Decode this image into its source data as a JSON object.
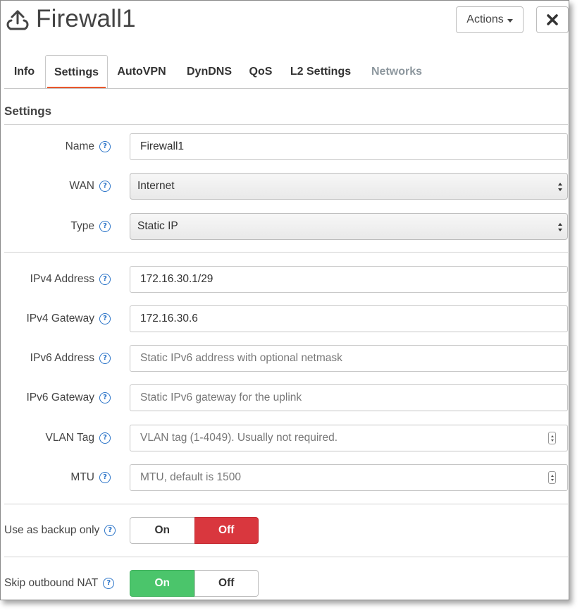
{
  "header": {
    "title": "Firewall1",
    "icon": "uplink-icon",
    "actions_label": "Actions",
    "close_icon": "close-icon"
  },
  "tabs": [
    {
      "label": "Info",
      "state": "normal"
    },
    {
      "label": "Settings",
      "state": "active"
    },
    {
      "label": "AutoVPN",
      "state": "normal"
    },
    {
      "label": "DynDNS",
      "state": "normal"
    },
    {
      "label": "QoS",
      "state": "normal"
    },
    {
      "label": "L2 Settings",
      "state": "normal"
    },
    {
      "label": "Networks",
      "state": "disabled"
    }
  ],
  "section": {
    "title": "Settings"
  },
  "help_glyph": "?",
  "fields": {
    "name": {
      "label": "Name",
      "value": "Firewall1"
    },
    "wan": {
      "label": "WAN",
      "value": "Internet"
    },
    "type": {
      "label": "Type",
      "value": "Static IP"
    },
    "ipv4_address": {
      "label": "IPv4 Address",
      "value": "172.16.30.1/29"
    },
    "ipv4_gateway": {
      "label": "IPv4 Gateway",
      "value": "172.16.30.6"
    },
    "ipv6_address": {
      "label": "IPv6 Address",
      "value": "",
      "placeholder": "Static IPv6 address with optional netmask"
    },
    "ipv6_gateway": {
      "label": "IPv6 Gateway",
      "value": "",
      "placeholder": "Static IPv6 gateway for the uplink"
    },
    "vlan_tag": {
      "label": "VLAN Tag",
      "value": "",
      "placeholder": "VLAN tag (1-4049). Usually not required."
    },
    "mtu": {
      "label": "MTU",
      "value": "",
      "placeholder": "MTU, default is 1500"
    }
  },
  "toggles": {
    "backup_only": {
      "label": "Use as backup only",
      "on_label": "On",
      "off_label": "Off",
      "selected": "Off"
    },
    "skip_nat": {
      "label": "Skip outbound NAT",
      "on_label": "On",
      "off_label": "Off",
      "selected": "On"
    }
  },
  "colors": {
    "accent_tab": "#e8572c",
    "toggle_on": "#4bc56b",
    "toggle_off": "#d9373e",
    "help_icon": "#2b74c8"
  }
}
